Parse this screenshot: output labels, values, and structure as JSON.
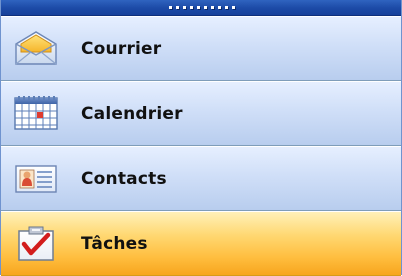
{
  "navigation_pane": {
    "items": [
      {
        "label": "Courrier",
        "icon": "mail-envelope-icon",
        "selected": false
      },
      {
        "label": "Calendrier",
        "icon": "calendar-icon",
        "selected": false
      },
      {
        "label": "Contacts",
        "icon": "contact-card-icon",
        "selected": false
      },
      {
        "label": "Tâches",
        "icon": "task-clipboard-check-icon",
        "selected": true
      }
    ]
  },
  "colors": {
    "splitter": "#1c4aa6",
    "item_background": "#d0dff8",
    "selected_background": "#ffbe3f",
    "border": "#7f9db9"
  }
}
